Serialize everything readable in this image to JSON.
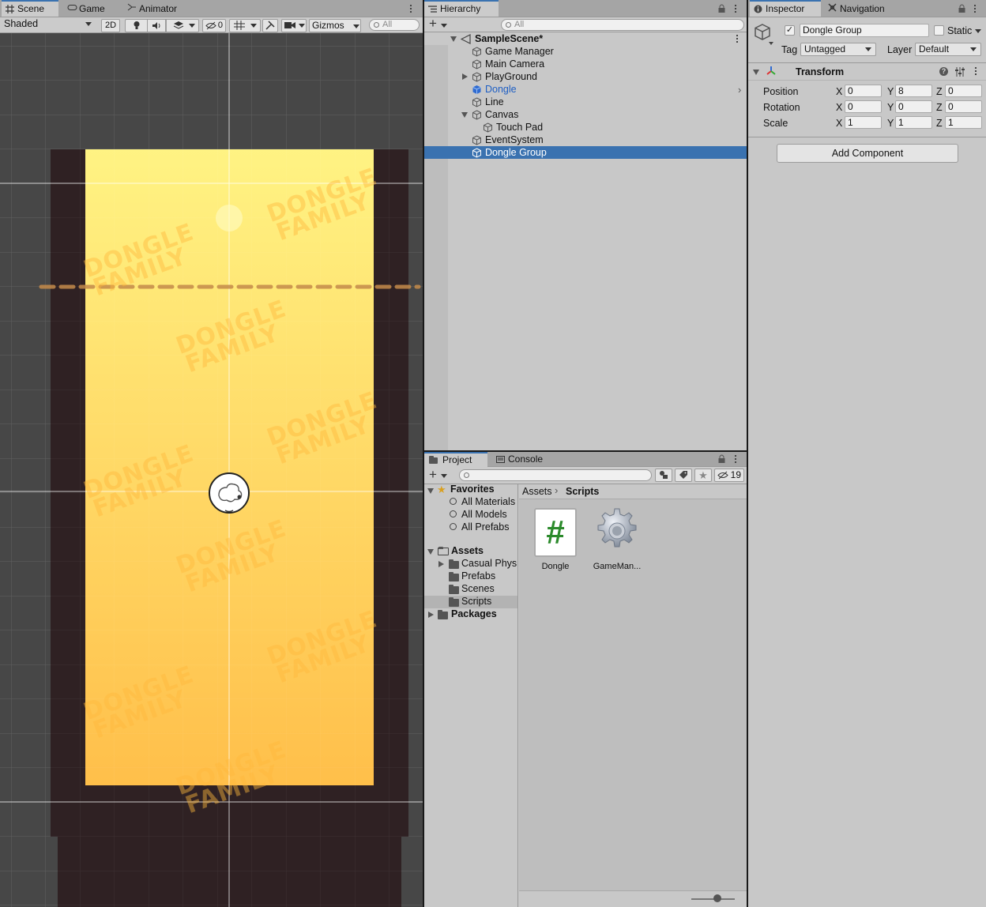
{
  "scene_panel": {
    "tabs": [
      {
        "label": "Scene",
        "icon": "grid-icon"
      },
      {
        "label": "Game",
        "icon": "gamepad-icon"
      },
      {
        "label": "Animator",
        "icon": "animator-icon"
      }
    ],
    "shading_mode": "Shaded",
    "mode_2d": "2D",
    "hidden_count": "0",
    "gizmos_label": "Gizmos",
    "search_placeholder": "All",
    "watermark": "DONGLE\nFAMILY",
    "colors": {
      "bg_dark": "#474747",
      "border": "#2f2123",
      "gradient_top": "#fff383",
      "gradient_bottom": "#ffbf4a",
      "deadline": "#c48a4a"
    }
  },
  "hierarchy": {
    "tab_label": "Hierarchy",
    "search_placeholder": "All",
    "scene_name": "SampleScene*",
    "items": [
      {
        "label": "Game Manager"
      },
      {
        "label": "Main Camera"
      },
      {
        "label": "PlayGround"
      },
      {
        "label": "Dongle"
      },
      {
        "label": "Line"
      },
      {
        "label": "Canvas"
      },
      {
        "label": "Touch Pad"
      },
      {
        "label": "EventSystem"
      },
      {
        "label": "Dongle Group"
      }
    ],
    "selected": "Dongle Group",
    "prefab_color": "#2f6bd1"
  },
  "project": {
    "tabs": [
      {
        "label": "Project",
        "icon": "folder-icon"
      },
      {
        "label": "Console",
        "icon": "console-icon"
      }
    ],
    "hidden_count": "19",
    "favorites_label": "Favorites",
    "favorites": [
      "All Materials",
      "All Models",
      "All Prefabs"
    ],
    "assets_label": "Assets",
    "asset_folders": [
      "Casual Phys",
      "Prefabs",
      "Scenes",
      "Scripts"
    ],
    "packages_label": "Packages",
    "breadcrumb": [
      "Assets",
      "Scripts"
    ],
    "files": [
      {
        "label": "Dongle",
        "icon": "csharp-script-icon"
      },
      {
        "label": "GameMan...",
        "icon": "gear-icon"
      }
    ]
  },
  "inspector": {
    "tabs": [
      {
        "label": "Inspector",
        "icon": "info-icon"
      },
      {
        "label": "Navigation",
        "icon": "navigation-icon"
      }
    ],
    "object_name": "Dongle Group",
    "static_label": "Static",
    "tag_label": "Tag",
    "tag_value": "Untagged",
    "layer_label": "Layer",
    "layer_value": "Default",
    "component_title": "Transform",
    "rows": [
      {
        "label": "Position",
        "x": "0",
        "y": "8",
        "z": "0"
      },
      {
        "label": "Rotation",
        "x": "0",
        "y": "0",
        "z": "0"
      },
      {
        "label": "Scale",
        "x": "1",
        "y": "1",
        "z": "1"
      }
    ],
    "axis_labels": [
      "X",
      "Y",
      "Z"
    ],
    "add_component": "Add Component"
  }
}
